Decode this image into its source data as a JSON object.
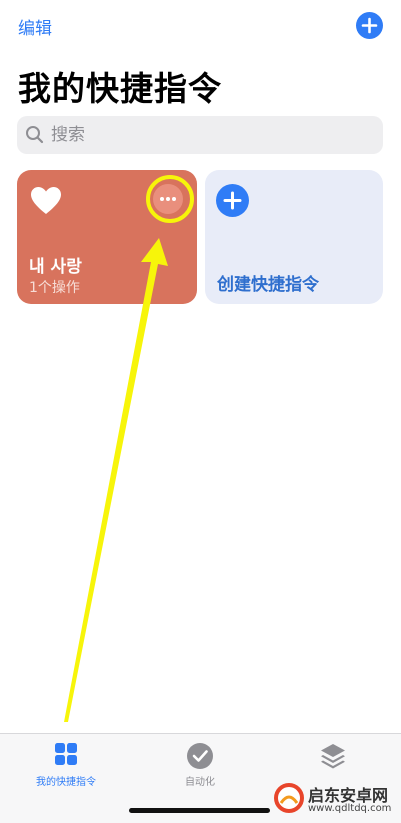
{
  "header": {
    "edit_label": "编辑",
    "add_icon": "plus-circle-icon",
    "title": "我的快捷指令"
  },
  "search": {
    "placeholder": "搜索",
    "icon": "search-icon"
  },
  "shortcuts": [
    {
      "name": "내 사랑",
      "actions": "1个操作",
      "icon": "heart-icon",
      "color": "#d8735d"
    }
  ],
  "create_card": {
    "label": "创建快捷指令",
    "icon": "plus-circle-icon"
  },
  "annotation": {
    "color": "#f7f50a",
    "shapes": [
      "circle-highlight",
      "arrow"
    ]
  },
  "tabbar": {
    "tabs": [
      {
        "label": "我的快捷指令",
        "icon": "grid-icon",
        "active": true
      },
      {
        "label": "自动化",
        "icon": "clock-check-icon",
        "active": false
      },
      {
        "label": "",
        "icon": "layers-icon",
        "active": false
      }
    ]
  },
  "watermark": {
    "title": "启东安卓网",
    "url": "www.qdltdq.com"
  },
  "colors": {
    "accent": "#2f7cf6",
    "shortcut_card": "#d8735d",
    "create_card": "#e8ecf8"
  }
}
